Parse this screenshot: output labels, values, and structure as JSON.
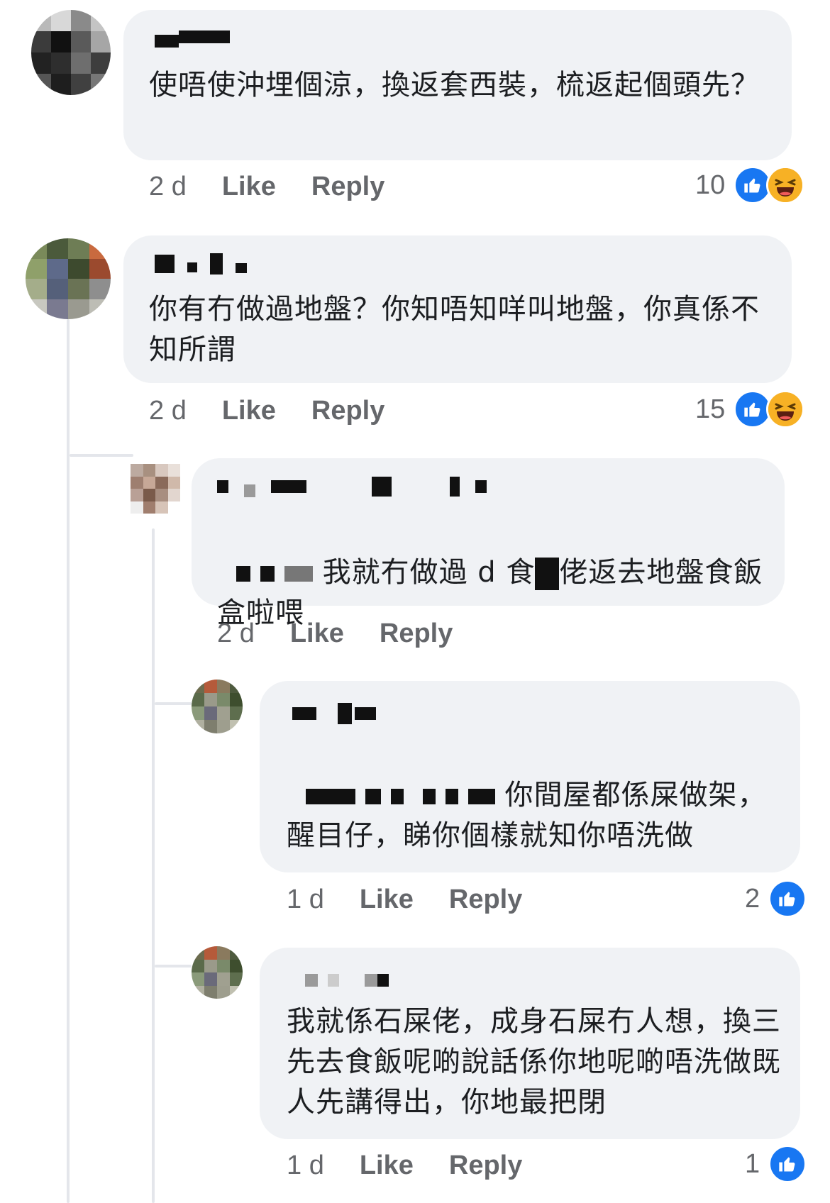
{
  "comments": [
    {
      "text": "使唔使沖埋個涼，換返套西裝，梳返起個頭先？",
      "age": "2 d",
      "like_label": "Like",
      "reply_label": "Reply",
      "reaction_count": "10",
      "reactions": [
        "like-icon",
        "haha-icon"
      ]
    },
    {
      "text": "你有冇做過地盤？你知唔知咩叫地盤，你真係不知所謂",
      "age": "2 d",
      "like_label": "Like",
      "reply_label": "Reply",
      "reaction_count": "15",
      "reactions": [
        "like-icon",
        "haha-icon"
      ]
    },
    {
      "text": "我就冇做過 d 食",
      "text_after": "佬返去地盤食飯盒啦喂",
      "age": "2 d",
      "like_label": "Like",
      "reply_label": "Reply"
    },
    {
      "text": "你間屋都係屎做架，醒目仔，睇你個樣就知你唔洗做",
      "age": "1 d",
      "like_label": "Like",
      "reply_label": "Reply",
      "reaction_count": "2",
      "reactions": [
        "like-icon"
      ]
    },
    {
      "text": "我就係石屎佬，成身石屎冇人想，換三先去食飯呢啲說話係你地呢啲唔洗做既人先講得出，你地最把閉",
      "age": "1 d",
      "like_label": "Like",
      "reply_label": "Reply",
      "reaction_count": "1",
      "reactions": [
        "like-icon"
      ]
    }
  ],
  "colors": {
    "bubble": "#f0f2f5",
    "meta": "#65676b",
    "like_blue": "#1877f2",
    "haha_yellow": "#f7b125"
  }
}
